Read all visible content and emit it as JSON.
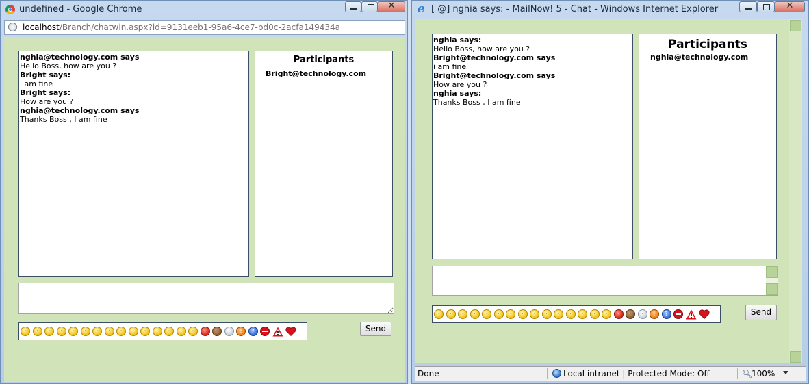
{
  "chrome_window": {
    "title": "undefined - Google Chrome",
    "url_host": "localhost",
    "url_path": "/Branch/chatwin.aspx?id=9131eeb1-95a6-4ce7-bd0c-2acfa149434a",
    "messages": [
      {
        "sender": "nghia@technology.com says",
        "text": "Hello Boss, how are you ?"
      },
      {
        "sender": "Bright says:",
        "text": "i am fine"
      },
      {
        "sender": "Bright says:",
        "text": "How are you ?"
      },
      {
        "sender": "nghia@technology.com says",
        "text": "Thanks Boss , I am fine"
      }
    ],
    "participants_title": "Participants",
    "participants": [
      "Bright@technology.com"
    ],
    "message_input_value": "",
    "send_label": "Send"
  },
  "ie_window": {
    "title": "[ @] nghia says: - MailNow! 5 - Chat - Windows Internet Explorer",
    "messages": [
      {
        "sender": "nghia says:",
        "text": "Hello Boss, how are you ?"
      },
      {
        "sender": "Bright@technology.com says",
        "text": "i am fine"
      },
      {
        "sender": "Bright@technology.com says",
        "text": "How are you ?"
      },
      {
        "sender": "nghia says:",
        "text": "Thanks Boss , I am fine"
      }
    ],
    "participants_title": "Participants",
    "participants": [
      "nghia@technology.com"
    ],
    "message_input_value": "",
    "send_label": "Send",
    "status": {
      "text": "Done",
      "zone": "Local intranet | Protected Mode: Off",
      "zoom": "100%"
    }
  },
  "emoticons": [
    "smile",
    "sad",
    "wink",
    "tongue",
    "grin",
    "neutral",
    "surprised",
    "blush",
    "glasses",
    "confused",
    "cool",
    "laugh",
    "cry",
    "angry-tongue",
    "happy",
    "devil",
    "monkey",
    "lightbulb",
    "exclamation",
    "question",
    "no-entry",
    "warning",
    "heart"
  ],
  "colors": {
    "page_bg": "#d1e3b9",
    "window_frame": "#b7cde8",
    "box_border": "#3a4f64"
  }
}
